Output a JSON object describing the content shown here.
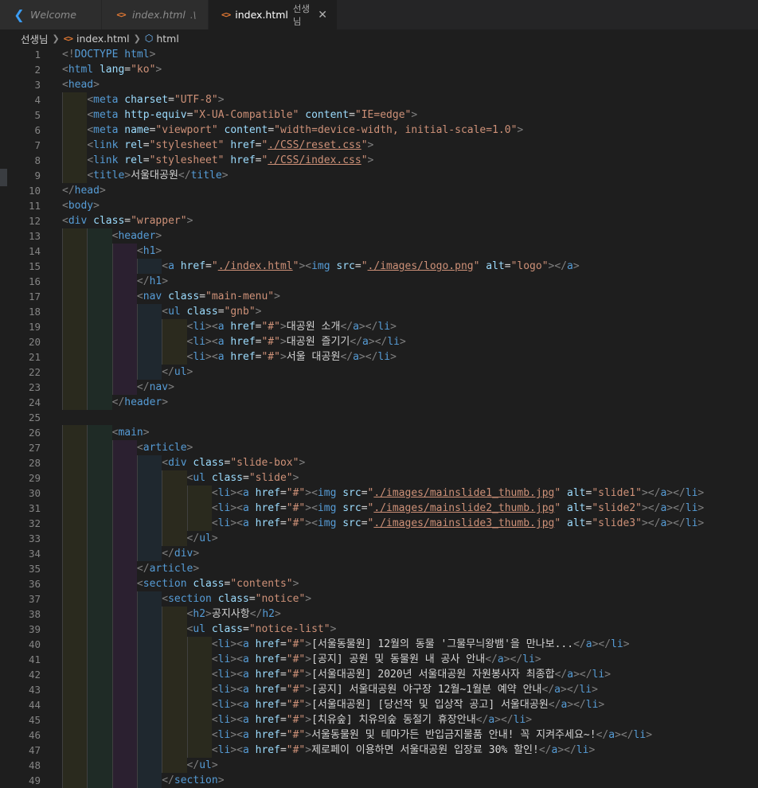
{
  "tabs": [
    {
      "label": "Welcome",
      "desc": "",
      "icon": "vscode-icon",
      "active": false
    },
    {
      "label": "index.html",
      "desc": ".\\",
      "icon": "html-file-icon",
      "active": false
    },
    {
      "label": "index.html",
      "desc": "선생님",
      "icon": "html-file-icon",
      "active": true
    }
  ],
  "breadcrumb": {
    "folder": "선생님",
    "file": "index.html",
    "symbol": "html"
  },
  "colors": {
    "tag_bracket": "#808080",
    "tag_name": "#569cd6",
    "attr_name": "#9cdcfe",
    "attr_value": "#ce9178",
    "text": "#d4d4d4"
  },
  "code_lines": [
    "<!DOCTYPE html>",
    "<html lang=\"ko\">",
    "<head>",
    "    <meta charset=\"UTF-8\">",
    "    <meta http-equiv=\"X-UA-Compatible\" content=\"IE=edge\">",
    "    <meta name=\"viewport\" content=\"width=device-width, initial-scale=1.0\">",
    "    <link rel=\"stylesheet\" href=\"./CSS/reset.css\">",
    "    <link rel=\"stylesheet\" href=\"./CSS/index.css\">",
    "    <title>서울대공원</title>",
    "</head>",
    "<body>",
    "<div class=\"wrapper\">",
    "        <header>",
    "            <h1>",
    "                <a href=\"./index.html\"><img src=\"./images/logo.png\" alt=\"logo\"></a>",
    "            </h1>",
    "            <nav class=\"main-menu\">",
    "                <ul class=\"gnb\">",
    "                    <li><a href=\"#\">대공원 소개</a></li>",
    "                    <li><a href=\"#\">대공원 즐기기</a></li>",
    "                    <li><a href=\"#\">서울 대공원</a></li>",
    "                </ul>",
    "            </nav>",
    "        </header>",
    "",
    "        <main>",
    "            <article>",
    "                <div class=\"slide-box\">",
    "                    <ul class=\"slide\">",
    "                        <li><a href=\"#\"><img src=\"./images/mainslide1_thumb.jpg\" alt=\"slide1\"></a></li>",
    "                        <li><a href=\"#\"><img src=\"./images/mainslide2_thumb.jpg\" alt=\"slide2\"></a></li>",
    "                        <li><a href=\"#\"><img src=\"./images/mainslide3_thumb.jpg\" alt=\"slide3\"></a></li>",
    "                    </ul>",
    "                </div>",
    "            </article>",
    "            <section class=\"contents\">",
    "                <section class=\"notice\">",
    "                    <h2>공지사항</h2>",
    "                    <ul class=\"notice-list\">",
    "                        <li><a href=\"#\">[서울동물원] 12월의 동물 '그물무늬왕뱀'을 만나보...</a></li>",
    "                        <li><a href=\"#\">[공지] 공원 및 동물원 내 공사 안내</a></li>",
    "                        <li><a href=\"#\">[서울대공원] 2020년 서울대공원 자원봉사자 최종합</a></li>",
    "                        <li><a href=\"#\">[공지] 서울대공원 야구장 12월~1월분 예약 안내</a></li>",
    "                        <li><a href=\"#\">[서울대공원] [당선작 및 입상작 공고] 서울대공원</a></li>",
    "                        <li><a href=\"#\">[치유숲] 치유의숲 동절기 휴장안내</a></li>",
    "                        <li><a href=\"#\">서울동물원 및 테마가든 반입금지물품 안내! 꼭 지켜주세요~!</a></li>",
    "                        <li><a href=\"#\">제로페이 이용하면 서울대공원 입장료 30% 할인!</a></li>",
    "                    </ul>",
    "                </section>"
  ]
}
